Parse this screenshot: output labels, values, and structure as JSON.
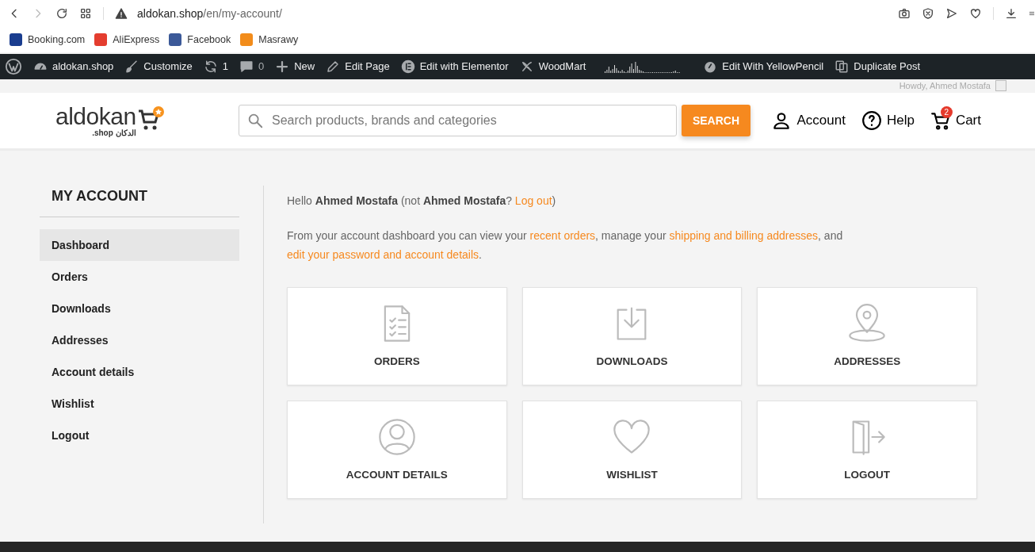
{
  "browser": {
    "url_host": "aldokan.shop",
    "url_path": "/en/my-account/"
  },
  "bookmarks": [
    {
      "label": "Booking.com",
      "color": "#1a3d8f"
    },
    {
      "label": "AliExpress",
      "color": "#e43d2f"
    },
    {
      "label": "Facebook",
      "color": "#3b5998"
    },
    {
      "label": "Masrawy",
      "color": "#f28c1b"
    }
  ],
  "admin_bar": [
    {
      "kind": "wp"
    },
    {
      "kind": "site",
      "label": "aldokan.shop"
    },
    {
      "kind": "customize",
      "label": "Customize"
    },
    {
      "kind": "updates",
      "label": "1"
    },
    {
      "kind": "comments",
      "label": "0"
    },
    {
      "kind": "new",
      "label": "New"
    },
    {
      "kind": "edit",
      "label": "Edit Page"
    },
    {
      "kind": "elementor",
      "label": "Edit with Elementor"
    },
    {
      "kind": "woodmart",
      "label": "WoodMart"
    },
    {
      "kind": "graph"
    },
    {
      "kind": "yellowpencil",
      "label": "Edit With YellowPencil"
    },
    {
      "kind": "duplicate",
      "label": "Duplicate Post"
    }
  ],
  "logo": {
    "name": "aldokan",
    "tagline": ".shop الدكان"
  },
  "top_strip": {
    "greeting": "Howdy, Ahmed Mostafa"
  },
  "header": {
    "search": {
      "placeholder": "Search products, brands and categories",
      "button": "SEARCH"
    },
    "links": [
      {
        "kind": "account",
        "label": "Account"
      },
      {
        "kind": "help",
        "label": "Help"
      },
      {
        "kind": "cart",
        "label": "Cart",
        "badge": "2"
      }
    ]
  },
  "sidebar": {
    "title": "MY ACCOUNT",
    "items": [
      {
        "label": "Dashboard",
        "selected": true
      },
      {
        "label": "Orders",
        "selected": false
      },
      {
        "label": "Downloads",
        "selected": false
      },
      {
        "label": "Addresses",
        "selected": false
      },
      {
        "label": "Account details",
        "selected": false
      },
      {
        "label": "Wishlist",
        "selected": false
      },
      {
        "label": "Logout",
        "selected": false
      }
    ]
  },
  "greeting": "Hello **Ahmed Mostafa** (not **Ahmed Mostafa**? ",
  "greeting_link": "Log out",
  "greeting_end": ")",
  "intro": [
    {
      "text": "From your account dashboard you can view your "
    },
    {
      "text": "recent orders",
      "link": true
    },
    {
      "text": ", manage your "
    },
    {
      "text": "shipping and billing addresses",
      "link": true
    },
    {
      "text": ", and "
    },
    {
      "text": "edit your password and account details",
      "link": true
    },
    {
      "text": "."
    }
  ],
  "cards": [
    {
      "kind": "orders",
      "label": "ORDERS"
    },
    {
      "kind": "downloads",
      "label": "DOWNLOADS"
    },
    {
      "kind": "addresses",
      "label": "ADDRESSES"
    },
    {
      "kind": "account",
      "label": "ACCOUNT DETAILS"
    },
    {
      "kind": "wishlist",
      "label": "WISHLIST"
    },
    {
      "kind": "logout",
      "label": "LOGOUT"
    }
  ]
}
